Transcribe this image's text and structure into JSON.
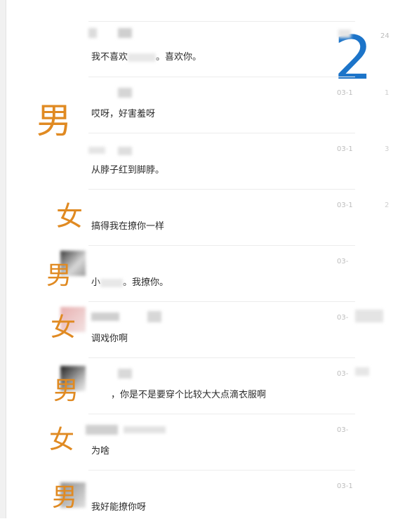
{
  "page_number": "2",
  "messages": [
    {
      "text_a": "我不喜欢",
      "text_b": "。喜欢你。",
      "time": "24",
      "gender": ""
    },
    {
      "text": "哎呀，好害羞呀",
      "time": "03-1",
      "side": "1",
      "gender": "男"
    },
    {
      "text": "从脖子红到脚脖。",
      "time": "03-1",
      "side": "3",
      "gender": ""
    },
    {
      "text": "搞得我在撩你一样",
      "time": "03-1",
      "side": "2",
      "gender": "女"
    },
    {
      "text_a": "小",
      "text_b": "。我撩你。",
      "time": "03-",
      "gender": "男"
    },
    {
      "text": "调戏你啊",
      "time": "03-",
      "gender": "女"
    },
    {
      "text": "，你是不是要穿个比较大大点滴衣服啊",
      "time": "03-",
      "gender": "男"
    },
    {
      "text": "为啥",
      "time": "03-",
      "gender": "女"
    },
    {
      "text": "我好能撩你呀",
      "time": "03-1",
      "gender": "男"
    }
  ]
}
